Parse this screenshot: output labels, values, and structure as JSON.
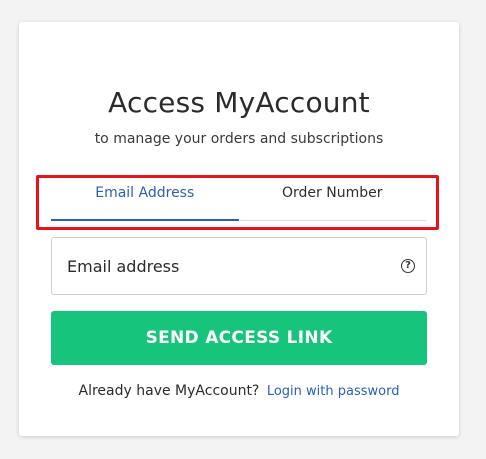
{
  "card": {
    "title": "Access MyAccount",
    "subtitle": "to manage your orders and subscriptions"
  },
  "tabs": [
    {
      "label": "Email Address",
      "active": true
    },
    {
      "label": "Order Number",
      "active": false
    }
  ],
  "email": {
    "placeholder": "Email address",
    "value": "",
    "help_icon": "help-circle-icon",
    "help_glyph": "?"
  },
  "send_button": {
    "label": "SEND ACCESS LINK"
  },
  "footer": {
    "prompt": "Already have MyAccount?",
    "link": "Login with password"
  },
  "colors": {
    "accent": "#2b5fb8",
    "button": "#17c47c",
    "highlight": "#e3151a"
  }
}
